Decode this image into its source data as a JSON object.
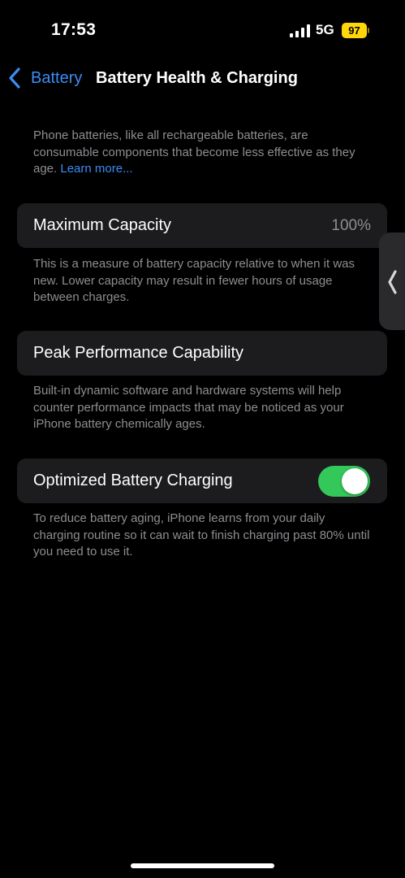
{
  "status_bar": {
    "time": "17:53",
    "network": "5G",
    "battery_level": "97",
    "icons": [
      "signal-bars-icon",
      "battery-icon"
    ]
  },
  "nav": {
    "back_label": "Battery",
    "title": "Battery Health & Charging",
    "back_icon": "chevron-left-icon"
  },
  "intro": {
    "text": "Phone batteries, like all rechargeable batteries, are consumable components that become less effective as they age.",
    "link": "Learn more..."
  },
  "max_capacity": {
    "label": "Maximum Capacity",
    "value": "100%",
    "description": "This is a measure of battery capacity relative to when it was new. Lower capacity may result in fewer hours of usage between charges."
  },
  "peak_performance": {
    "label": "Peak Performance Capability",
    "description": "Built-in dynamic software and hardware systems will help counter performance impacts that may be noticed as your iPhone battery chemically ages."
  },
  "optimized_charging": {
    "label": "Optimized Battery Charging",
    "enabled": true,
    "description": "To reduce battery aging, iPhone learns from your daily charging routine so it can wait to finish charging past 80% until you need to use it."
  },
  "colors": {
    "accent": "#3b8cf5",
    "toggle_on": "#34c759",
    "battery": "#ffd60a",
    "cell_bg": "#1c1c1e",
    "secondary_text": "#8e8e93"
  }
}
